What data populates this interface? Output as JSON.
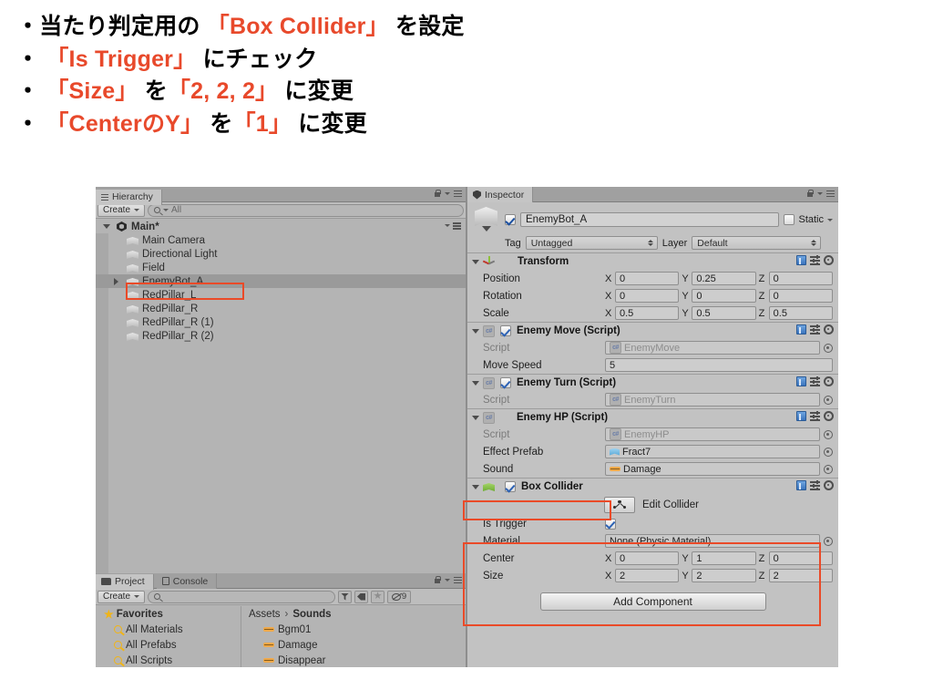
{
  "slide": {
    "bullets": [
      [
        {
          "t": "・当たり判定用の ",
          "hl": false
        },
        {
          "t": "「Box Collider」",
          "hl": true
        },
        {
          "t": " を設定",
          "hl": false
        }
      ],
      [
        {
          "t": "・ ",
          "hl": false
        },
        {
          "t": "「Is Trigger」",
          "hl": true
        },
        {
          "t": " にチェック",
          "hl": false
        }
      ],
      [
        {
          "t": "・ ",
          "hl": false
        },
        {
          "t": "「Size」",
          "hl": true
        },
        {
          "t": " を",
          "hl": false
        },
        {
          "t": "「2, 2, 2」",
          "hl": true
        },
        {
          "t": " に変更",
          "hl": false
        }
      ],
      [
        {
          "t": "・ ",
          "hl": false
        },
        {
          "t": "「CenterのY」",
          "hl": true
        },
        {
          "t": " を",
          "hl": false
        },
        {
          "t": "「1」",
          "hl": true
        },
        {
          "t": " に変更",
          "hl": false
        }
      ]
    ],
    "highlight_color": "#e8492b",
    "text_color": "#000000"
  },
  "hierarchy": {
    "tab_label": "Hierarchy",
    "create_label": "Create",
    "search_value": "All",
    "search_placeholder": "All",
    "root_label": "Main*",
    "items": [
      {
        "label": "Main Camera",
        "selected": false,
        "expandable": false
      },
      {
        "label": "Directional Light",
        "selected": false,
        "expandable": false
      },
      {
        "label": "Field",
        "selected": false,
        "expandable": false
      },
      {
        "label": "EnemyBot_A",
        "selected": true,
        "expandable": true
      },
      {
        "label": "RedPillar_L",
        "selected": false,
        "expandable": false
      },
      {
        "label": "RedPillar_R",
        "selected": false,
        "expandable": false
      },
      {
        "label": "RedPillar_R (1)",
        "selected": false,
        "expandable": false
      },
      {
        "label": "RedPillar_R (2)",
        "selected": false,
        "expandable": false
      }
    ]
  },
  "inspector": {
    "tab_label": "Inspector",
    "object": {
      "enabled": true,
      "name": "EnemyBot_A",
      "static_label": "Static",
      "static_checked": false,
      "tag_label": "Tag",
      "tag_value": "Untagged",
      "layer_label": "Layer",
      "layer_value": "Default"
    },
    "components": [
      {
        "title": "Transform",
        "icon": "transform-axis-icon",
        "has_checkbox": false,
        "rows": [
          {
            "type": "vec3",
            "label": "Position",
            "x": "0",
            "y": "0.25",
            "z": "0"
          },
          {
            "type": "vec3",
            "label": "Rotation",
            "x": "0",
            "y": "0",
            "z": "0"
          },
          {
            "type": "vec3",
            "label": "Scale",
            "x": "0.5",
            "y": "0.5",
            "z": "0.5"
          }
        ]
      },
      {
        "title": "Enemy Move (Script)",
        "icon": "csharp-script-icon",
        "has_checkbox": true,
        "checked": true,
        "rows": [
          {
            "type": "objref",
            "label": "Script",
            "value": "EnemyMove",
            "dim": true,
            "icon": "csharp-script-icon"
          },
          {
            "type": "text",
            "label": "Move Speed",
            "value": "5"
          }
        ]
      },
      {
        "title": "Enemy Turn (Script)",
        "icon": "csharp-script-icon",
        "has_checkbox": true,
        "checked": true,
        "rows": [
          {
            "type": "objref",
            "label": "Script",
            "value": "EnemyTurn",
            "dim": true,
            "icon": "csharp-script-icon"
          }
        ]
      },
      {
        "title": "Enemy HP (Script)",
        "icon": "csharp-script-icon",
        "has_checkbox": false,
        "rows": [
          {
            "type": "objref",
            "label": "Script",
            "value": "EnemyHP",
            "dim": true,
            "icon": "csharp-script-icon"
          },
          {
            "type": "objref",
            "label": "Effect Prefab",
            "value": "Fract7",
            "dim": false,
            "icon": "prefab-cube-icon"
          },
          {
            "type": "objref",
            "label": "Sound",
            "value": "Damage",
            "dim": false,
            "icon": "audio-clip-icon"
          }
        ]
      },
      {
        "title": "Box Collider",
        "icon": "box-collider-icon",
        "has_checkbox": true,
        "checked": true,
        "edit_collider_label": "Edit Collider",
        "rows": [
          {
            "type": "bool",
            "label": "Is Trigger",
            "checked": true
          },
          {
            "type": "objref",
            "label": "Material",
            "value": "None (Physic Material)",
            "dim": false,
            "icon": "none"
          },
          {
            "type": "vec3",
            "label": "Center",
            "x": "0",
            "y": "1",
            "z": "0"
          },
          {
            "type": "vec3",
            "label": "Size",
            "x": "2",
            "y": "2",
            "z": "2"
          }
        ]
      }
    ],
    "add_component_label": "Add Component"
  },
  "project": {
    "tab_label": "Project",
    "console_tab_label": "Console",
    "create_label": "Create",
    "search_value": "",
    "search_placeholder": "",
    "hidden_count": "9",
    "favorites_label": "Favorites",
    "favorites": [
      {
        "label": "All Materials"
      },
      {
        "label": "All Prefabs"
      },
      {
        "label": "All Scripts"
      }
    ],
    "breadcrumb": [
      "Assets",
      "Sounds"
    ],
    "assets": [
      {
        "label": "Bgm01",
        "icon": "audio-clip-icon"
      },
      {
        "label": "Damage",
        "icon": "audio-clip-icon"
      },
      {
        "label": "Disappear",
        "icon": "audio-clip-icon"
      }
    ]
  },
  "annotations": {
    "color": "#ea4a28",
    "boxes": [
      {
        "name": "hierarchy-enemybot-highlight"
      },
      {
        "name": "box-collider-header-highlight"
      },
      {
        "name": "box-collider-properties-highlight"
      }
    ]
  }
}
